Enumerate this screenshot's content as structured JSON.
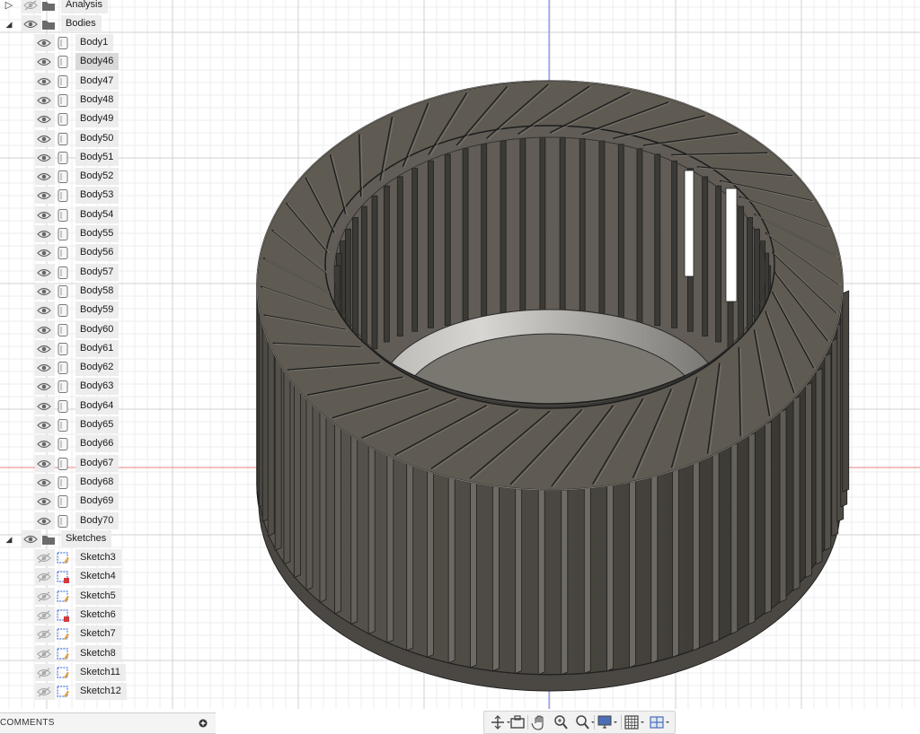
{
  "browser": {
    "folders": {
      "analysis": "Analysis",
      "bodies": "Bodies",
      "sketches": "Sketches"
    },
    "bodies": [
      "Body1",
      "Body46",
      "Body47",
      "Body48",
      "Body49",
      "Body50",
      "Body51",
      "Body52",
      "Body53",
      "Body54",
      "Body55",
      "Body56",
      "Body57",
      "Body58",
      "Body59",
      "Body60",
      "Body61",
      "Body62",
      "Body63",
      "Body64",
      "Body65",
      "Body66",
      "Body67",
      "Body68",
      "Body69",
      "Body70"
    ],
    "selected_body": "Body46",
    "sketches": [
      {
        "name": "Sketch3",
        "locked": false
      },
      {
        "name": "Sketch4",
        "locked": true
      },
      {
        "name": "Sketch5",
        "locked": false
      },
      {
        "name": "Sketch6",
        "locked": true
      },
      {
        "name": "Sketch7",
        "locked": false
      },
      {
        "name": "Sketch8",
        "locked": false
      },
      {
        "name": "Sketch11",
        "locked": false
      },
      {
        "name": "Sketch12",
        "locked": false
      }
    ]
  },
  "comments": {
    "label": "COMMENTS"
  },
  "navbar": {
    "tools": [
      "orbit-icon",
      "look-at-icon",
      "pan-icon",
      "zoom-icon",
      "zoom-window-icon",
      "display-settings-icon",
      "grid-settings-icon",
      "viewports-icon"
    ]
  },
  "colors": {
    "model": "#57534b",
    "model_dark": "#3e3b35",
    "grid": "#dcdcdc",
    "axis_red": "#e05050",
    "axis_blue": "#5a6ee0"
  }
}
